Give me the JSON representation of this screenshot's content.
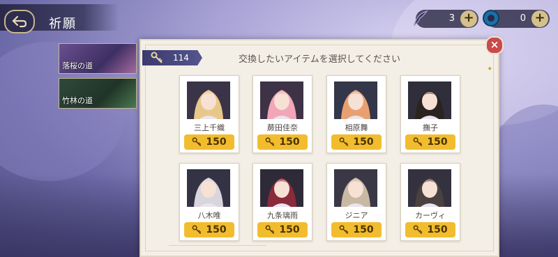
{
  "header": {
    "title": "祈願"
  },
  "currency": [
    {
      "icon": "feather-ticket-icon",
      "count": "3"
    },
    {
      "icon": "blue-gem-icon",
      "count": "0"
    }
  ],
  "routes": [
    {
      "label": "落桜の道"
    },
    {
      "label": "竹林の道"
    }
  ],
  "modal": {
    "key_count": "114",
    "title": "交換したいアイテムを選択してください"
  },
  "items": [
    {
      "name": "三上千織",
      "price": "150",
      "hair": "#e8c88a",
      "bg": "#3b3448"
    },
    {
      "name": "蕨田佳奈",
      "price": "150",
      "hair": "#f2a6b8",
      "bg": "#3d3246"
    },
    {
      "name": "相原舞",
      "price": "150",
      "hair": "#e9a070",
      "bg": "#34364a"
    },
    {
      "name": "撫子",
      "price": "150",
      "hair": "#2a2320",
      "bg": "#2f2e3a"
    },
    {
      "name": "八木唯",
      "price": "150",
      "hair": "#d8d6dc",
      "bg": "#333345"
    },
    {
      "name": "九条璃雨",
      "price": "150",
      "hair": "#8a2a3a",
      "bg": "#2e2a38"
    },
    {
      "name": "ジニア",
      "price": "150",
      "hair": "#c9b8a4",
      "bg": "#3a3846"
    },
    {
      "name": "カーヴィ",
      "price": "150",
      "hair": "#4a4240",
      "bg": "#34323e"
    }
  ]
}
